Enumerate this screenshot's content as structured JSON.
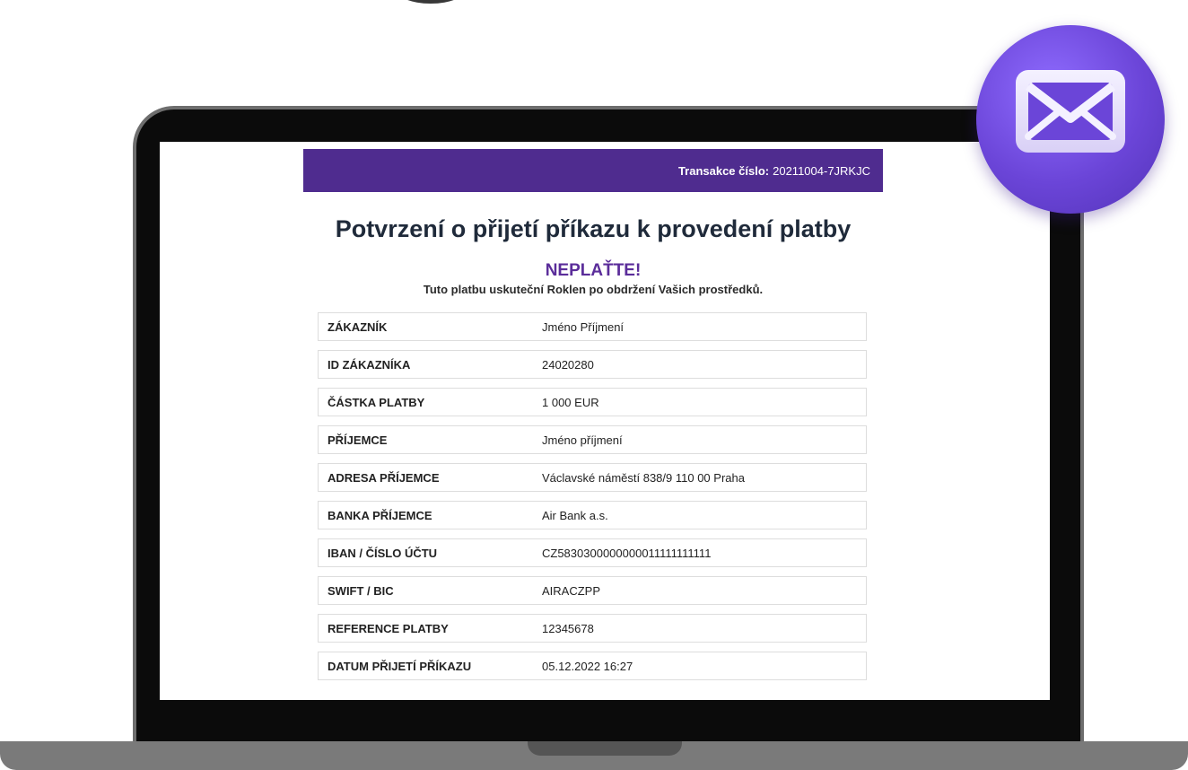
{
  "transaction": {
    "label": "Transakce číslo:",
    "number": "20211004-7JRKJC"
  },
  "title": "Potvrzení o přijetí příkazu k provedení platby",
  "warning": {
    "headline": "NEPLAŤTE!",
    "text": "Tuto platbu uskuteční Roklen po obdržení Vašich prostředků."
  },
  "details": [
    {
      "label": "ZÁKAZNÍK",
      "value": "Jméno Příjmení"
    },
    {
      "label": "ID ZÁKAZNÍKA",
      "value": "24020280"
    },
    {
      "label": "ČÁSTKA PLATBY",
      "value": "1 000 EUR"
    },
    {
      "label": "PŘÍJEMCE",
      "value": "Jméno příjmení"
    },
    {
      "label": "ADRESA PŘÍJEMCE",
      "value": "Václavské náměstí 838/9 110 00 Praha"
    },
    {
      "label": "BANKA PŘÍJEMCE",
      "value": "Air Bank a.s."
    },
    {
      "label": "IBAN / ČÍSLO ÚČTU",
      "value": "CZ5830300000000011111111111"
    },
    {
      "label": "SWIFT / BIC",
      "value": "AIRACZPP"
    },
    {
      "label": "REFERENCE PLATBY",
      "value": "12345678"
    },
    {
      "label": "DATUM PŘIJETÍ PŘÍKAZU",
      "value": "05.12.2022 16:27"
    }
  ],
  "colors": {
    "brand_purple": "#4f2c8f",
    "warning_purple": "#5b2d9a",
    "badge_purple": "#6b45d8"
  },
  "icons": {
    "badge": "envelope-icon"
  }
}
